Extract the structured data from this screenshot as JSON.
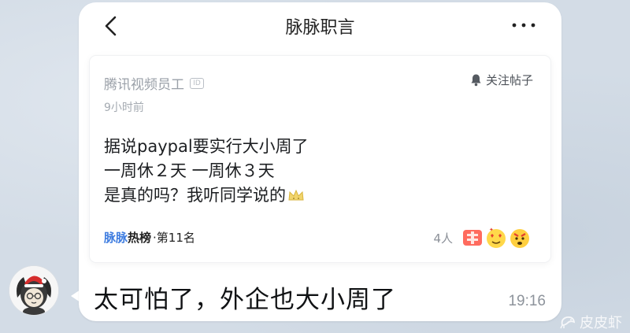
{
  "header": {
    "title": "脉脉职言",
    "back_icon": "chevron-left-icon",
    "more_icon": "more-horizontal-icon"
  },
  "post": {
    "author": "腾讯视频员工",
    "verified_badge": "ID",
    "time_ago": "9小时前",
    "follow_label": "关注帖子",
    "body_lines": [
      "据说paypal要实行大小周了",
      "一周休２天 一周休３天",
      "是真的吗？我听同学说的"
    ],
    "hot_brand": "脉脉",
    "hot_label": "热榜",
    "hot_rank": "·第11名",
    "reaction_count": "4人"
  },
  "message": {
    "text": "太可怕了，外企也大小周了",
    "time": "19:16"
  },
  "watermark": {
    "text": "皮皮虾"
  },
  "colors": {
    "accent_blue": "#3f7de0",
    "bubble_bg": "#ffffff",
    "chat_bg": "#d3dce6"
  }
}
